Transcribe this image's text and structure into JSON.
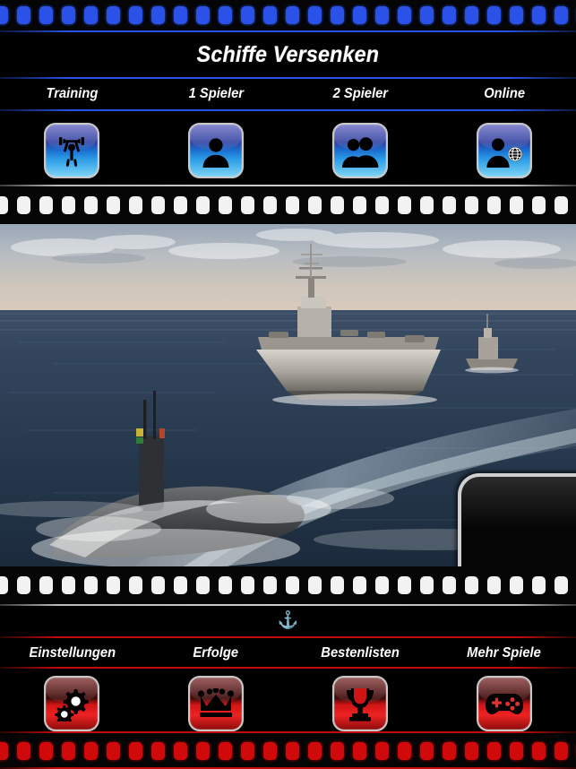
{
  "app": {
    "title": "Schiffe Versenken",
    "accent_blue": "#2a52e8",
    "accent_red": "#d00a0a",
    "background": "#000000"
  },
  "top_nav": {
    "items": [
      {
        "label": "Training",
        "icon": "weightlifter-icon"
      },
      {
        "label": "1 Spieler",
        "icon": "single-person-icon"
      },
      {
        "label": "2 Spieler",
        "icon": "two-persons-icon"
      },
      {
        "label": "Online",
        "icon": "person-globe-icon"
      }
    ]
  },
  "hero": {
    "alt": "Flugzeugtraeger und U-Boot auf See",
    "mascot": "naval-officer-mascot"
  },
  "divider": {
    "anchor_glyph": "⚓"
  },
  "bottom_nav": {
    "items": [
      {
        "label": "Einstellungen",
        "icon": "gears-icon"
      },
      {
        "label": "Erfolge",
        "icon": "crown-icon"
      },
      {
        "label": "Bestenlisten",
        "icon": "trophy-icon"
      },
      {
        "label": "Mehr Spiele",
        "icon": "gamepad-icon"
      }
    ]
  }
}
